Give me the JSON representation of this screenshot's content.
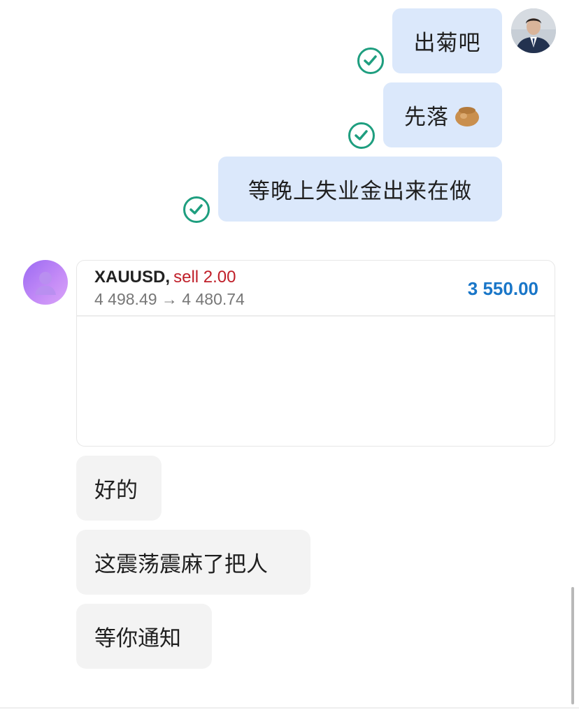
{
  "colors": {
    "outgoing_bubble": "#dbe8fb",
    "incoming_bubble": "#f3f3f3",
    "read_check": "#1e9e7f",
    "sell_red": "#c0202a",
    "profit_blue": "#1976c8"
  },
  "outgoing_messages": [
    {
      "text": "出菊吧",
      "status_icon": "read-check-icon"
    },
    {
      "text": "先落",
      "status_icon": "read-check-icon"
    },
    {
      "text": "等晚上失业金出来在做",
      "status_icon": "read-check-icon"
    }
  ],
  "trade_card": {
    "symbol": "XAUUSD,",
    "side": "sell 2.00",
    "prices": "4 498.49 → 4 480.74",
    "profit": "3 550.00"
  },
  "incoming_messages": [
    {
      "text": "好的"
    },
    {
      "text": "这震荡震麻了把人"
    },
    {
      "text": "等你通知"
    }
  ]
}
